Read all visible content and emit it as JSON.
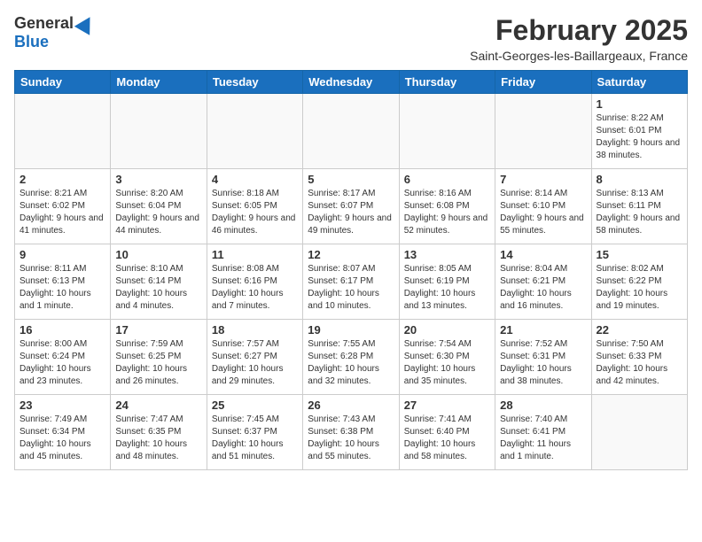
{
  "header": {
    "logo_general": "General",
    "logo_blue": "Blue",
    "month": "February 2025",
    "location": "Saint-Georges-les-Baillargeaux, France"
  },
  "days_of_week": [
    "Sunday",
    "Monday",
    "Tuesday",
    "Wednesday",
    "Thursday",
    "Friday",
    "Saturday"
  ],
  "weeks": [
    [
      {
        "day": "",
        "info": ""
      },
      {
        "day": "",
        "info": ""
      },
      {
        "day": "",
        "info": ""
      },
      {
        "day": "",
        "info": ""
      },
      {
        "day": "",
        "info": ""
      },
      {
        "day": "",
        "info": ""
      },
      {
        "day": "1",
        "info": "Sunrise: 8:22 AM\nSunset: 6:01 PM\nDaylight: 9 hours and 38 minutes."
      }
    ],
    [
      {
        "day": "2",
        "info": "Sunrise: 8:21 AM\nSunset: 6:02 PM\nDaylight: 9 hours and 41 minutes."
      },
      {
        "day": "3",
        "info": "Sunrise: 8:20 AM\nSunset: 6:04 PM\nDaylight: 9 hours and 44 minutes."
      },
      {
        "day": "4",
        "info": "Sunrise: 8:18 AM\nSunset: 6:05 PM\nDaylight: 9 hours and 46 minutes."
      },
      {
        "day": "5",
        "info": "Sunrise: 8:17 AM\nSunset: 6:07 PM\nDaylight: 9 hours and 49 minutes."
      },
      {
        "day": "6",
        "info": "Sunrise: 8:16 AM\nSunset: 6:08 PM\nDaylight: 9 hours and 52 minutes."
      },
      {
        "day": "7",
        "info": "Sunrise: 8:14 AM\nSunset: 6:10 PM\nDaylight: 9 hours and 55 minutes."
      },
      {
        "day": "8",
        "info": "Sunrise: 8:13 AM\nSunset: 6:11 PM\nDaylight: 9 hours and 58 minutes."
      }
    ],
    [
      {
        "day": "9",
        "info": "Sunrise: 8:11 AM\nSunset: 6:13 PM\nDaylight: 10 hours and 1 minute."
      },
      {
        "day": "10",
        "info": "Sunrise: 8:10 AM\nSunset: 6:14 PM\nDaylight: 10 hours and 4 minutes."
      },
      {
        "day": "11",
        "info": "Sunrise: 8:08 AM\nSunset: 6:16 PM\nDaylight: 10 hours and 7 minutes."
      },
      {
        "day": "12",
        "info": "Sunrise: 8:07 AM\nSunset: 6:17 PM\nDaylight: 10 hours and 10 minutes."
      },
      {
        "day": "13",
        "info": "Sunrise: 8:05 AM\nSunset: 6:19 PM\nDaylight: 10 hours and 13 minutes."
      },
      {
        "day": "14",
        "info": "Sunrise: 8:04 AM\nSunset: 6:21 PM\nDaylight: 10 hours and 16 minutes."
      },
      {
        "day": "15",
        "info": "Sunrise: 8:02 AM\nSunset: 6:22 PM\nDaylight: 10 hours and 19 minutes."
      }
    ],
    [
      {
        "day": "16",
        "info": "Sunrise: 8:00 AM\nSunset: 6:24 PM\nDaylight: 10 hours and 23 minutes."
      },
      {
        "day": "17",
        "info": "Sunrise: 7:59 AM\nSunset: 6:25 PM\nDaylight: 10 hours and 26 minutes."
      },
      {
        "day": "18",
        "info": "Sunrise: 7:57 AM\nSunset: 6:27 PM\nDaylight: 10 hours and 29 minutes."
      },
      {
        "day": "19",
        "info": "Sunrise: 7:55 AM\nSunset: 6:28 PM\nDaylight: 10 hours and 32 minutes."
      },
      {
        "day": "20",
        "info": "Sunrise: 7:54 AM\nSunset: 6:30 PM\nDaylight: 10 hours and 35 minutes."
      },
      {
        "day": "21",
        "info": "Sunrise: 7:52 AM\nSunset: 6:31 PM\nDaylight: 10 hours and 38 minutes."
      },
      {
        "day": "22",
        "info": "Sunrise: 7:50 AM\nSunset: 6:33 PM\nDaylight: 10 hours and 42 minutes."
      }
    ],
    [
      {
        "day": "23",
        "info": "Sunrise: 7:49 AM\nSunset: 6:34 PM\nDaylight: 10 hours and 45 minutes."
      },
      {
        "day": "24",
        "info": "Sunrise: 7:47 AM\nSunset: 6:35 PM\nDaylight: 10 hours and 48 minutes."
      },
      {
        "day": "25",
        "info": "Sunrise: 7:45 AM\nSunset: 6:37 PM\nDaylight: 10 hours and 51 minutes."
      },
      {
        "day": "26",
        "info": "Sunrise: 7:43 AM\nSunset: 6:38 PM\nDaylight: 10 hours and 55 minutes."
      },
      {
        "day": "27",
        "info": "Sunrise: 7:41 AM\nSunset: 6:40 PM\nDaylight: 10 hours and 58 minutes."
      },
      {
        "day": "28",
        "info": "Sunrise: 7:40 AM\nSunset: 6:41 PM\nDaylight: 11 hours and 1 minute."
      },
      {
        "day": "",
        "info": ""
      }
    ]
  ]
}
